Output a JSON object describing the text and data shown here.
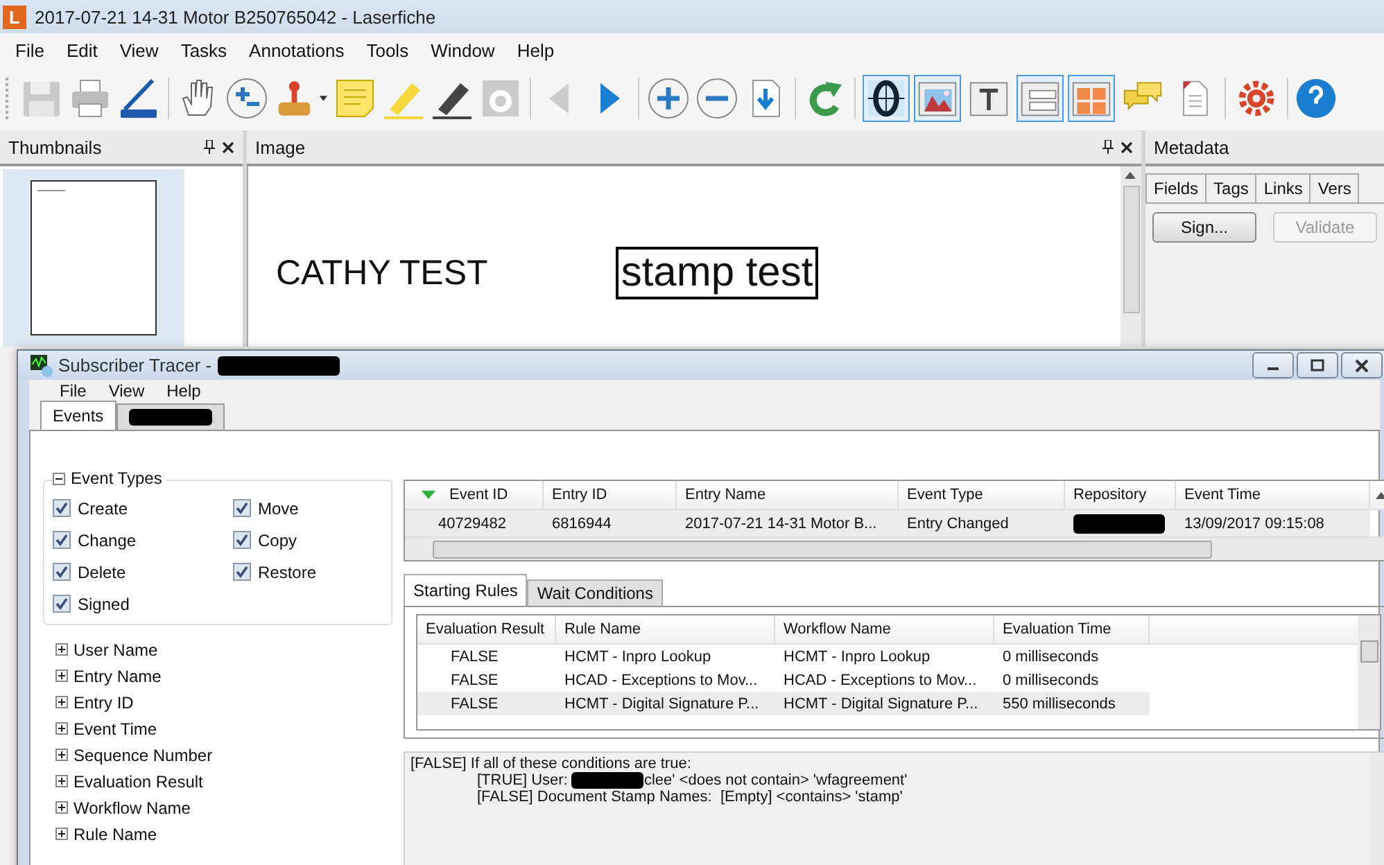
{
  "window": {
    "title": "2017-07-21 14-31 Motor B250765042 - Laserfiche",
    "app_icon": "L"
  },
  "menu": [
    "File",
    "Edit",
    "View",
    "Tasks",
    "Annotations",
    "Tools",
    "Window",
    "Help"
  ],
  "view_buttons": [
    {
      "kind": "ocr",
      "selected": true
    },
    {
      "kind": "image",
      "selected": true
    },
    {
      "kind": "text",
      "selected": false
    },
    {
      "kind": "fields",
      "selected": true
    },
    {
      "kind": "tiles",
      "selected": true
    },
    {
      "kind": "comments",
      "selected": false
    },
    {
      "kind": "document",
      "selected": false
    },
    {
      "kind": "settings",
      "selected": false
    }
  ],
  "panes": {
    "thumbnails": "Thumbnails",
    "image": "Image",
    "metadata": "Metadata"
  },
  "document": {
    "heading": "CATHY TEST",
    "stamp": "stamp test"
  },
  "metadata": {
    "tabs": [
      "Fields",
      "Tags",
      "Links",
      "Vers"
    ],
    "buttons": [
      {
        "label": "Sign...",
        "disabled": false
      },
      {
        "label": "Validate",
        "disabled": true
      }
    ]
  },
  "tracer": {
    "title": "Subscriber Tracer - ",
    "menu": [
      "File",
      "View",
      "Help"
    ],
    "tabs": [
      {
        "kind": "text",
        "label": "Events",
        "selected": true
      },
      {
        "kind": "redacted",
        "selected": false
      }
    ],
    "event_types": {
      "title": "Event Types",
      "expanded": true,
      "items": [
        {
          "label": "Create",
          "checked": true
        },
        {
          "label": "Move",
          "checked": true
        },
        {
          "label": "Change",
          "checked": true
        },
        {
          "label": "Copy",
          "checked": true
        },
        {
          "label": "Delete",
          "checked": true
        },
        {
          "label": "Restore",
          "checked": true
        },
        {
          "label": "Signed",
          "checked": true
        }
      ]
    },
    "filters": [
      {
        "label": "User Name",
        "expanded": false
      },
      {
        "label": "Entry Name",
        "expanded": false
      },
      {
        "label": "Entry ID",
        "expanded": false
      },
      {
        "label": "Event Time",
        "expanded": false
      },
      {
        "label": "Sequence Number",
        "expanded": false
      },
      {
        "label": "Evaluation Result",
        "expanded": false
      },
      {
        "label": "Workflow Name",
        "expanded": false
      },
      {
        "label": "Rule Name",
        "expanded": false
      }
    ],
    "events_grid": {
      "columns": [
        "Event ID",
        "Entry ID",
        "Entry Name",
        "Event Type",
        "Repository",
        "Event Time"
      ],
      "rows": [
        {
          "selected": true,
          "cells": [
            "40729482",
            "6816944",
            "2017-07-21 14-31 Motor B...",
            "Entry Changed",
            null,
            "13/09/2017 09:15:08"
          ]
        }
      ]
    },
    "rule_tabs": [
      {
        "label": "Starting Rules",
        "selected": true
      },
      {
        "label": "Wait Conditions",
        "selected": false
      }
    ],
    "rules_grid": {
      "columns": [
        "Evaluation Result",
        "Rule Name",
        "Workflow Name",
        "Evaluation Time"
      ],
      "rows": [
        {
          "selected": false,
          "cells": [
            "FALSE",
            "HCMT - Inpro Lookup",
            "HCMT - Inpro Lookup",
            "0 milliseconds"
          ]
        },
        {
          "selected": false,
          "cells": [
            "FALSE",
            "HCAD - Exceptions to Mov...",
            "HCAD - Exceptions to Mov...",
            "0 milliseconds"
          ]
        },
        {
          "selected": true,
          "cells": [
            "FALSE",
            "HCMT - Digital Signature P...",
            "HCMT - Digital Signature P...",
            "550 milliseconds"
          ]
        }
      ]
    },
    "details": {
      "text": "[FALSE] If all of these conditions are true:",
      "children": [
        {
          "text": "[TRUE] User: ",
          "rest": "clee' <does not contain> 'wfagreement'"
        },
        {
          "text": "[FALSE] Document Stamp Names:  [Empty] <contains> 'stamp'"
        }
      ]
    }
  }
}
